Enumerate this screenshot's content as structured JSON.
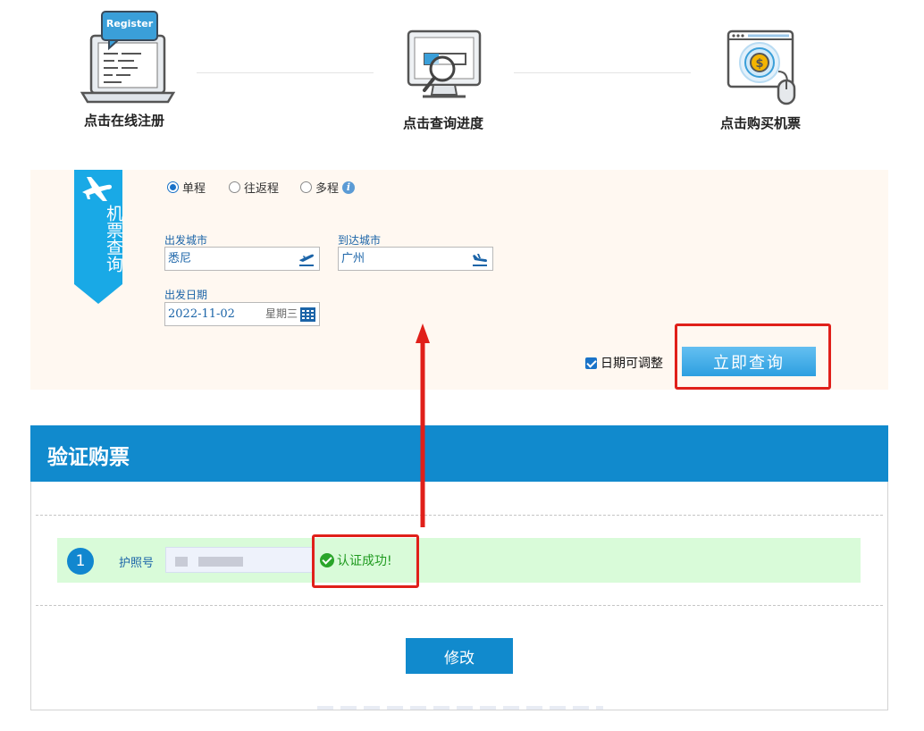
{
  "steps": [
    {
      "label": "点击在线注册",
      "icon": "register-laptop-icon",
      "badge": "Register"
    },
    {
      "label": "点击查询进度",
      "icon": "monitor-magnifier-icon"
    },
    {
      "label": "点击购买机票",
      "icon": "browser-coin-mouse-icon"
    }
  ],
  "search": {
    "ribbon_title": "机票查询",
    "ribbon_icon": "airplane-icon",
    "trip_types": [
      "单程",
      "往返程",
      "多程"
    ],
    "selected_trip": "单程",
    "departure": {
      "label": "出发城市",
      "value": "悉尼",
      "icon": "takeoff-icon"
    },
    "arrival": {
      "label": "到达城市",
      "value": "广州",
      "icon": "landing-icon"
    },
    "date": {
      "label": "出发日期",
      "value": "2022-11-02",
      "weekday": "星期三",
      "icon": "calendar-icon"
    },
    "date_adjustable": {
      "label": "日期可调整",
      "checked": true
    },
    "query_button": "立即查询"
  },
  "verify": {
    "title": "验证购票",
    "row_number": "1",
    "passport_label": "护照号",
    "status": "认证成功!",
    "modify_button": "修改"
  },
  "colors": {
    "primary_blue": "#118acd",
    "panel_bg": "#fff8f1",
    "success_green": "#1f9a1f",
    "annotation_red": "#e0201a"
  }
}
